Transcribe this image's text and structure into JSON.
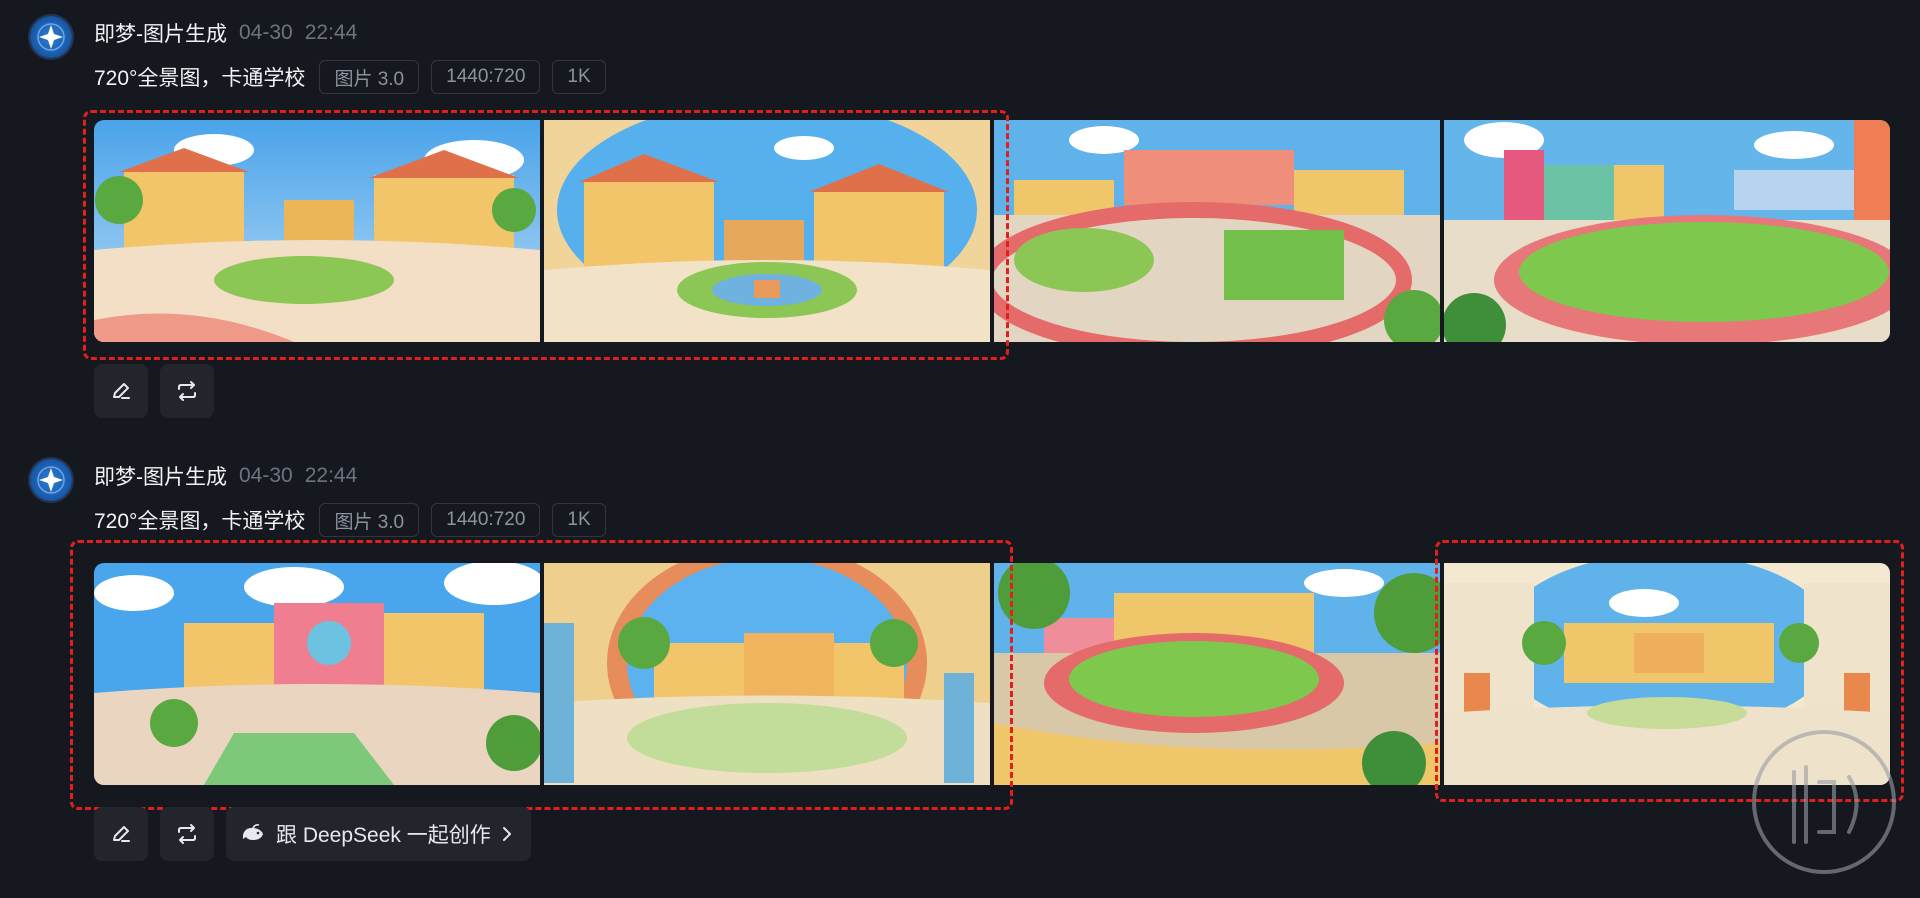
{
  "messages": [
    {
      "app_name": "即梦-图片生成",
      "date": "04-30",
      "time": "22:44",
      "prompt": "720°全景图，卡通学校",
      "tags": [
        "图片 3.0",
        "1440:720",
        "1K"
      ],
      "images": [
        {
          "name": "panorama-school-courtyard"
        },
        {
          "name": "panorama-school-fisheye-garden"
        },
        {
          "name": "panorama-school-playground-aerial"
        },
        {
          "name": "panorama-school-track-field"
        }
      ],
      "actions": [
        "edit-icon",
        "regenerate-icon"
      ]
    },
    {
      "app_name": "即梦-图片生成",
      "date": "04-30",
      "time": "22:44",
      "prompt": "720°全景图，卡通学校",
      "tags": [
        "图片 3.0",
        "1440:720",
        "1K"
      ],
      "images": [
        {
          "name": "panorama-school-front-court"
        },
        {
          "name": "panorama-school-arch-courtyard"
        },
        {
          "name": "panorama-school-stadium"
        },
        {
          "name": "panorama-school-inner-yard"
        }
      ],
      "actions": [
        "edit-icon",
        "regenerate-icon"
      ],
      "deepseek_label": "跟 DeepSeek 一起创作"
    }
  ],
  "colors": {
    "background": "#16181f",
    "annotation_dash": "#e0201c",
    "tag_border": "#33363f",
    "button_bg": "#23252d"
  }
}
